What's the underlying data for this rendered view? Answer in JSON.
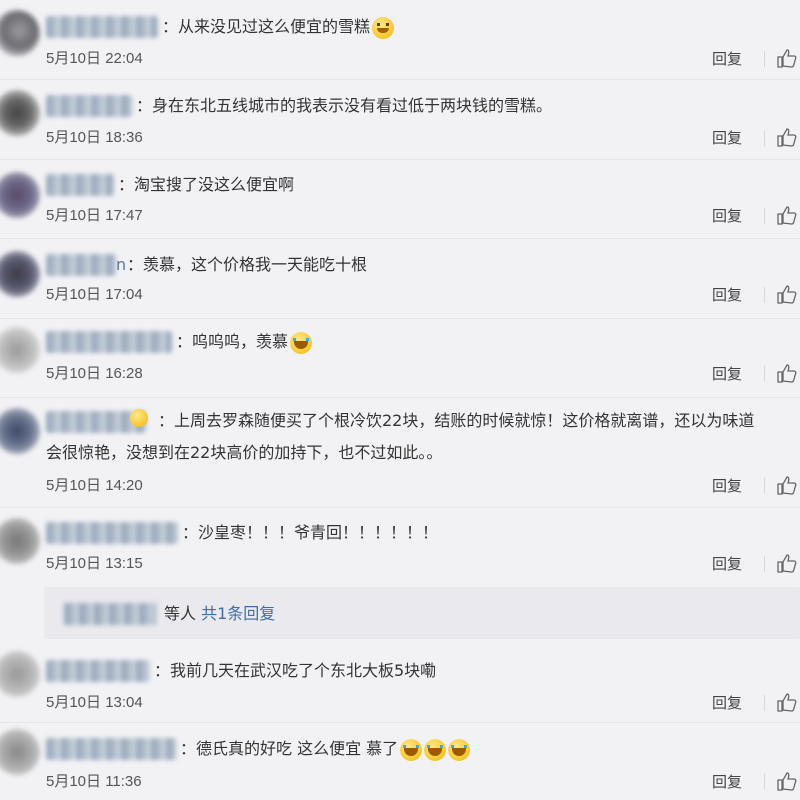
{
  "reply_label": "回复",
  "comments": [
    {
      "user_tail": "",
      "text": "：从来没见过这么便宜的雪糕",
      "time": "5月10日 22:04",
      "emoji": "smile"
    },
    {
      "user_tail": "",
      "text": "：身在东北五线城市的我表示没有看过低于两块钱的雪糕。",
      "time": "5月10日 18:36"
    },
    {
      "user_tail": "",
      "text": "：淘宝搜了没这么便宜啊",
      "time": "5月10日 17:47"
    },
    {
      "user_tail": "n",
      "text": "：羡慕，这个价格我一天能吃十根",
      "time": "5月10日 17:04"
    },
    {
      "user_tail": "",
      "text": "：呜呜呜，羡慕",
      "time": "5月10日 16:28",
      "emoji": "cry"
    },
    {
      "user_tail": "",
      "text": "：上周去罗森随便买了个根冷饮22块，结账的时候就惊！这价格就离谱，还以为味道",
      "text2": "会很惊艳，没想到在22块高价的加持下，也不过如此。。",
      "time": "5月10日 14:20"
    },
    {
      "user_tail": "",
      "text": "：沙皇枣！！！爷青回！！！！！！",
      "time": "5月10日 13:15"
    },
    {
      "user_tail": "",
      "text": "：我前几天在武汉吃了个东北大板5块嘞",
      "time": "5月10日 13:04"
    },
    {
      "user_tail": "",
      "text": "：德氏真的好吃 这么便宜 慕了",
      "time": "5月10日 11:36",
      "emoji": "cry3"
    }
  ],
  "replies_summary": {
    "suffix": "等人",
    "link": "共1条回复"
  }
}
